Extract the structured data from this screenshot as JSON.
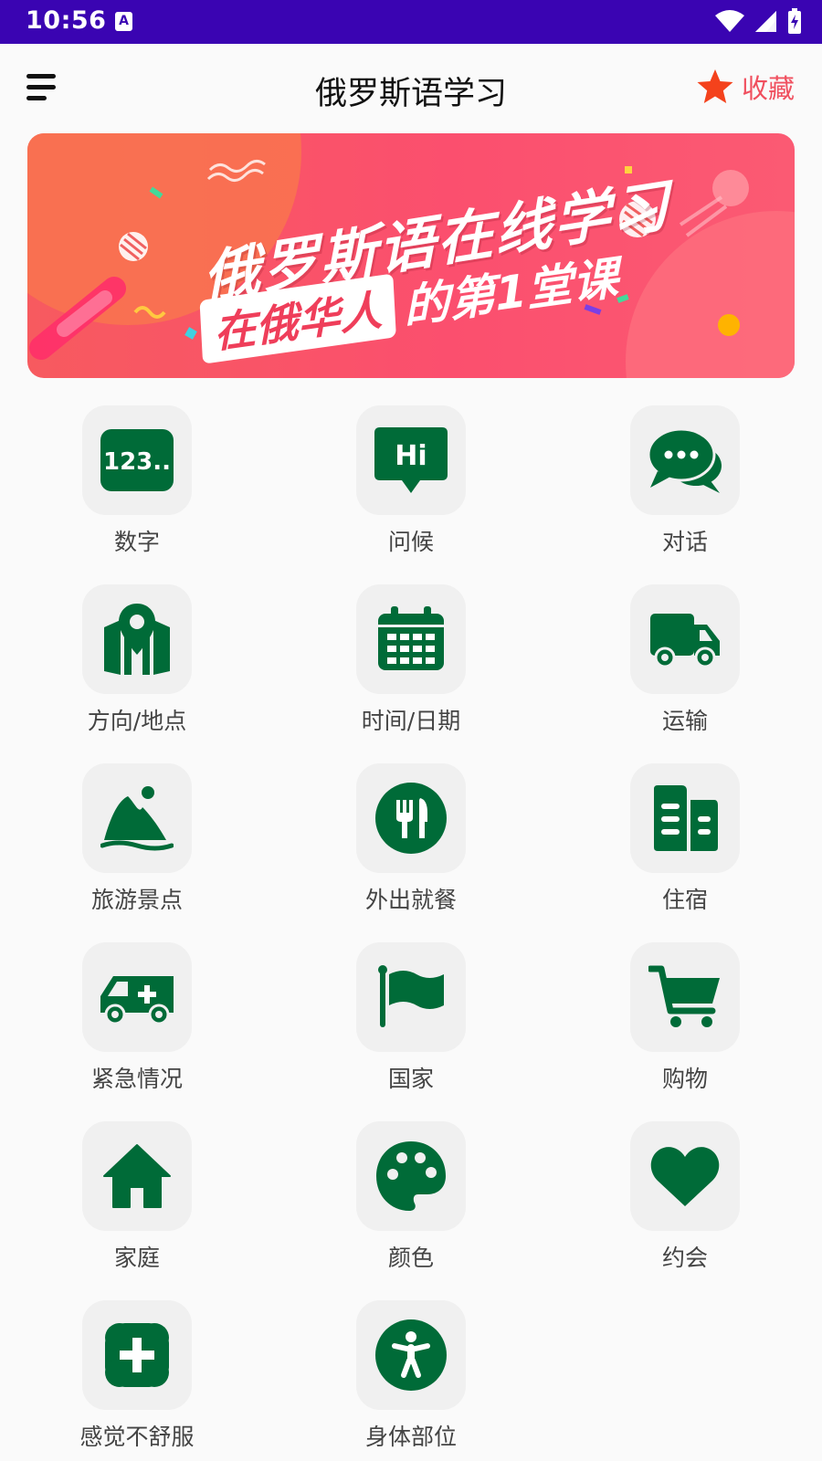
{
  "status_bar": {
    "time": "10:56",
    "notification_icon": "A"
  },
  "app_bar": {
    "title": "俄罗斯语学习",
    "favorite_label": "收藏"
  },
  "banner": {
    "line1": "俄罗斯语在线学习",
    "line2_highlight": "在俄华人",
    "line2_rest": "的第1堂课"
  },
  "categories": [
    {
      "label": "数字",
      "icon": "numbers-icon"
    },
    {
      "label": "问候",
      "icon": "greeting-hi-icon"
    },
    {
      "label": "对话",
      "icon": "chat-bubbles-icon"
    },
    {
      "label": "方向/地点",
      "icon": "map-pin-icon"
    },
    {
      "label": "时间/日期",
      "icon": "calendar-icon"
    },
    {
      "label": "运输",
      "icon": "truck-icon"
    },
    {
      "label": "旅游景点",
      "icon": "mountain-icon"
    },
    {
      "label": "外出就餐",
      "icon": "cutlery-icon"
    },
    {
      "label": "住宿",
      "icon": "buildings-icon"
    },
    {
      "label": "紧急情况",
      "icon": "ambulance-icon"
    },
    {
      "label": "国家",
      "icon": "flag-icon"
    },
    {
      "label": "购物",
      "icon": "cart-icon"
    },
    {
      "label": "家庭",
      "icon": "home-icon"
    },
    {
      "label": "颜色",
      "icon": "palette-icon"
    },
    {
      "label": "约会",
      "icon": "heart-icon"
    },
    {
      "label": "感觉不舒服",
      "icon": "medical-cross-icon"
    },
    {
      "label": "身体部位",
      "icon": "person-body-icon"
    }
  ],
  "colors": {
    "icon_green": "#006b38",
    "accent_pink": "#f0505f",
    "status_purple": "#3a04b2"
  }
}
